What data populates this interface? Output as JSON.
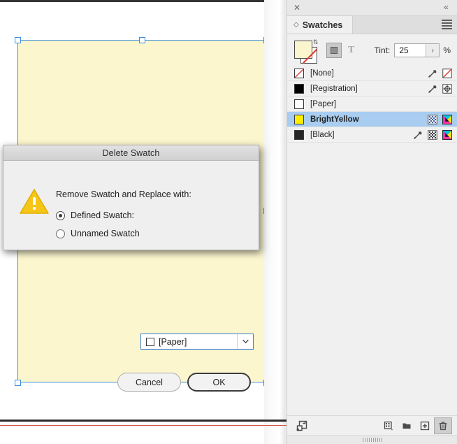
{
  "document": {
    "artwork_fill": "#fbf6cd",
    "selection_color": "#3c8ede",
    "guide_color": "#d4564a"
  },
  "dialog": {
    "title": "Delete Swatch",
    "prompt": "Remove Swatch and Replace with:",
    "warning_icon": "warning-triangle-icon",
    "options": [
      {
        "label": "Defined Swatch:",
        "selected": true
      },
      {
        "label": "Unnamed Swatch",
        "selected": false
      }
    ],
    "swatch_select": {
      "value": "[Paper]",
      "chip_color": "#ffffff",
      "arrow_icon": "chevron-down-icon"
    },
    "buttons": {
      "cancel": "Cancel",
      "ok": "OK"
    }
  },
  "panel": {
    "close_icon": "close-icon",
    "collapse_icon": "double-chevron-left-icon",
    "tab": {
      "label": "Swatches",
      "dock_icon": "diamond-arrows-icon"
    },
    "menu_icon": "hamburger-menu-icon",
    "controls": {
      "fill_color": "#fbf6cd",
      "stroke_color": "#ffffff",
      "swap_icon": "swap-fill-stroke-icon",
      "solid_mode_icon": "solid-color-icon",
      "text_mode_icon": "formatting-affects-text-icon",
      "text_mode_label": "T",
      "tint_label": "Tint:",
      "tint_value": "25",
      "tint_percent": "%",
      "tint_arrow_icon": "chevron-right-icon"
    },
    "swatches": [
      {
        "name": "[None]",
        "chip_color": "#ffffff",
        "chip_kind": "none",
        "selected": false,
        "bold": false,
        "icons": [
          "spot-dropper-icon",
          "none-swatch-icon"
        ]
      },
      {
        "name": "[Registration]",
        "chip_color": "#000000",
        "chip_kind": "solid",
        "selected": false,
        "bold": false,
        "icons": [
          "spot-dropper-icon",
          "registration-target-icon"
        ]
      },
      {
        "name": "[Paper]",
        "chip_color": "#ffffff",
        "chip_kind": "solid",
        "selected": false,
        "bold": false,
        "icons": []
      },
      {
        "name": "BrightYellow",
        "chip_color": "#ffee00",
        "chip_kind": "solid",
        "selected": true,
        "bold": true,
        "icons": [
          "process-checker-icon",
          "cmyk-color-icon"
        ]
      },
      {
        "name": "[Black]",
        "chip_color": "#262626",
        "chip_kind": "solid",
        "selected": false,
        "bold": false,
        "icons": [
          "spot-dropper-icon",
          "process-checker-icon",
          "cmyk-color-icon"
        ]
      }
    ],
    "footer": {
      "buttons": [
        {
          "name": "show-swatch-sets-icon"
        },
        {
          "name": "new-color-group-icon"
        },
        {
          "name": "new-swatch-folder-icon"
        },
        {
          "name": "new-swatch-icon"
        },
        {
          "name": "delete-swatch-icon"
        }
      ]
    }
  }
}
